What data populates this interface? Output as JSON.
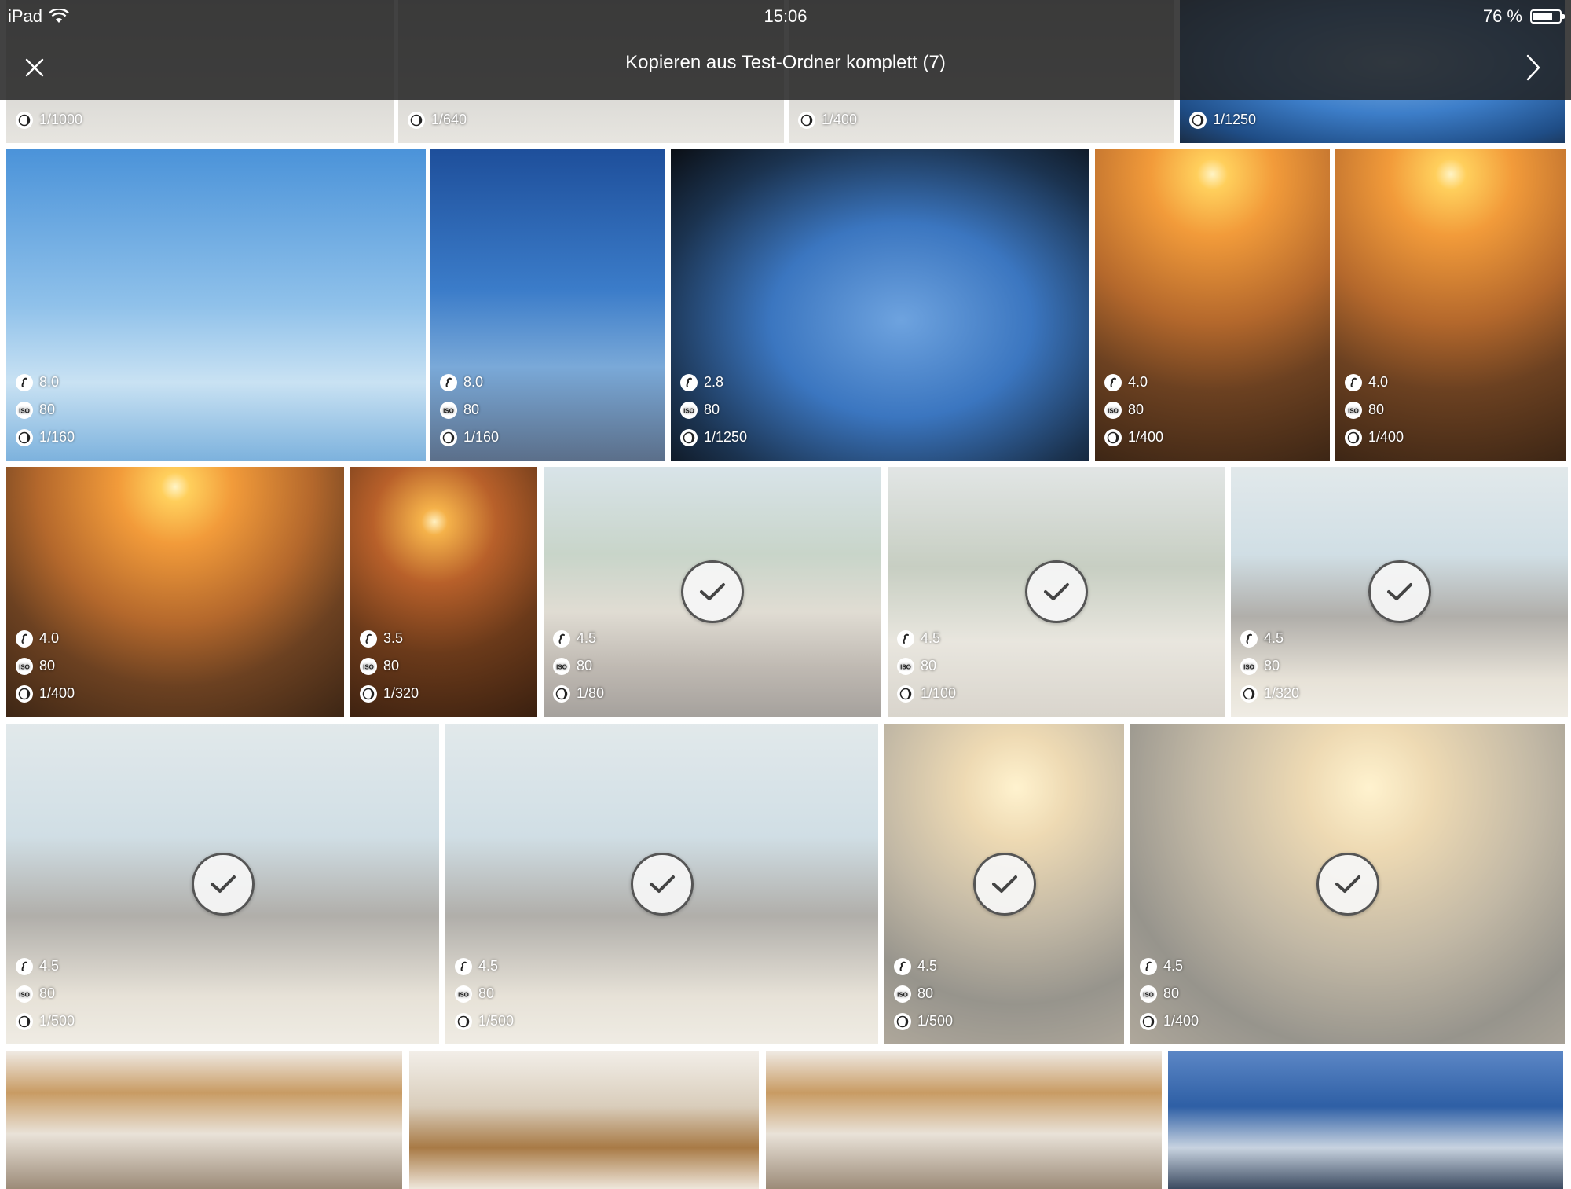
{
  "status_bar": {
    "device": "iPad",
    "time": "15:06",
    "battery": "76 %",
    "battery_level": 0.76
  },
  "header": {
    "title": "Kopieren aus Test-Ordner komplett (7)",
    "close_icon": "close-icon",
    "next_icon": "chevron-right-icon"
  },
  "exif_icons": {
    "aperture": "aperture-icon",
    "iso": "iso-icon",
    "shutter": "shutter-icon"
  },
  "colors": {
    "header_bg": "#232323",
    "check_border": "#555555"
  },
  "rows": [
    {
      "photos": [
        {
          "aperture": "",
          "iso": "",
          "shutter": "1/1000",
          "selected": false
        },
        {
          "aperture": "",
          "iso": "",
          "shutter": "1/640",
          "selected": false
        },
        {
          "aperture": "",
          "iso": "",
          "shutter": "1/400",
          "selected": false
        },
        {
          "aperture": "",
          "iso": "",
          "shutter": "1/1250",
          "selected": false
        }
      ]
    },
    {
      "photos": [
        {
          "aperture": "8.0",
          "iso": "80",
          "shutter": "1/160",
          "selected": false
        },
        {
          "aperture": "8.0",
          "iso": "80",
          "shutter": "1/160",
          "selected": false
        },
        {
          "aperture": "2.8",
          "iso": "80",
          "shutter": "1/1250",
          "selected": false
        },
        {
          "aperture": "4.0",
          "iso": "80",
          "shutter": "1/400",
          "selected": false
        },
        {
          "aperture": "4.0",
          "iso": "80",
          "shutter": "1/400",
          "selected": false
        }
      ]
    },
    {
      "photos": [
        {
          "aperture": "4.0",
          "iso": "80",
          "shutter": "1/400",
          "selected": false
        },
        {
          "aperture": "3.5",
          "iso": "80",
          "shutter": "1/320",
          "selected": false
        },
        {
          "aperture": "4.5",
          "iso": "80",
          "shutter": "1/80",
          "selected": true
        },
        {
          "aperture": "4.5",
          "iso": "80",
          "shutter": "1/100",
          "selected": true
        },
        {
          "aperture": "4.5",
          "iso": "80",
          "shutter": "1/320",
          "selected": true
        }
      ]
    },
    {
      "photos": [
        {
          "aperture": "4.5",
          "iso": "80",
          "shutter": "1/500",
          "selected": true
        },
        {
          "aperture": "4.5",
          "iso": "80",
          "shutter": "1/500",
          "selected": true
        },
        {
          "aperture": "4.5",
          "iso": "80",
          "shutter": "1/500",
          "selected": true
        },
        {
          "aperture": "4.5",
          "iso": "80",
          "shutter": "1/400",
          "selected": true
        }
      ]
    },
    {
      "photos": [
        {
          "aperture": "",
          "iso": "",
          "shutter": "",
          "selected": false
        },
        {
          "aperture": "",
          "iso": "",
          "shutter": "",
          "selected": false
        },
        {
          "aperture": "",
          "iso": "",
          "shutter": "",
          "selected": false
        },
        {
          "aperture": "",
          "iso": "",
          "shutter": "",
          "selected": false
        }
      ]
    }
  ]
}
